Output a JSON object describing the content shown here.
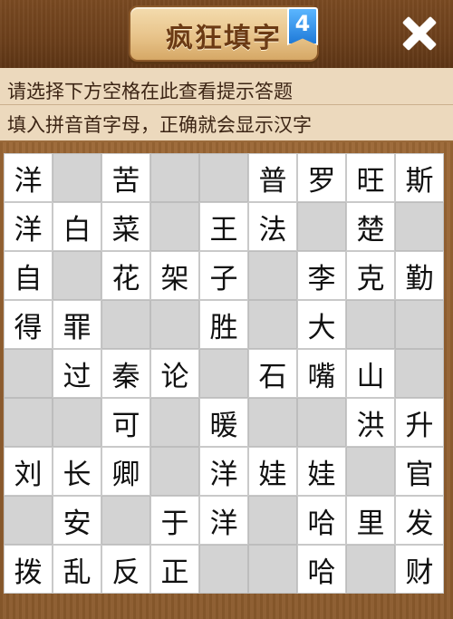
{
  "header": {
    "title": "疯狂填字",
    "level_badge": "4",
    "close_icon": "close-icon"
  },
  "hint": {
    "line1": "请选择下方空格在此查看提示答题",
    "line2": "填入拼音首字母，正确就会显示汉字"
  },
  "colors": {
    "header_bg": "#6b3f1b",
    "hint_bg": "#ecd9bd",
    "board_bg": "#8a5a2c",
    "blank_cell": "#d3d3d3",
    "filled_cell": "#ffffff",
    "badge": "#1f7ad8"
  },
  "grid": [
    [
      "洋",
      "",
      "苦",
      "",
      "",
      "普",
      "罗",
      "旺",
      "斯"
    ],
    [
      "洋",
      "白",
      "菜",
      "",
      "王",
      "法",
      "",
      "楚",
      ""
    ],
    [
      "自",
      "",
      "花",
      "架",
      "子",
      "",
      "李",
      "克",
      "勤"
    ],
    [
      "得",
      "罪",
      "",
      "",
      "胜",
      "",
      "大",
      "",
      ""
    ],
    [
      "",
      "过",
      "秦",
      "论",
      "",
      "石",
      "嘴",
      "山",
      ""
    ],
    [
      "",
      "",
      "可",
      "",
      "暖",
      "",
      "",
      "洪",
      "升"
    ],
    [
      "刘",
      "长",
      "卿",
      "",
      "洋",
      "娃",
      "娃",
      "",
      "官"
    ],
    [
      "",
      "安",
      "",
      "于",
      "洋",
      "",
      "哈",
      "里",
      "发"
    ],
    [
      "拨",
      "乱",
      "反",
      "正",
      "",
      "",
      "哈",
      "",
      "财"
    ]
  ]
}
